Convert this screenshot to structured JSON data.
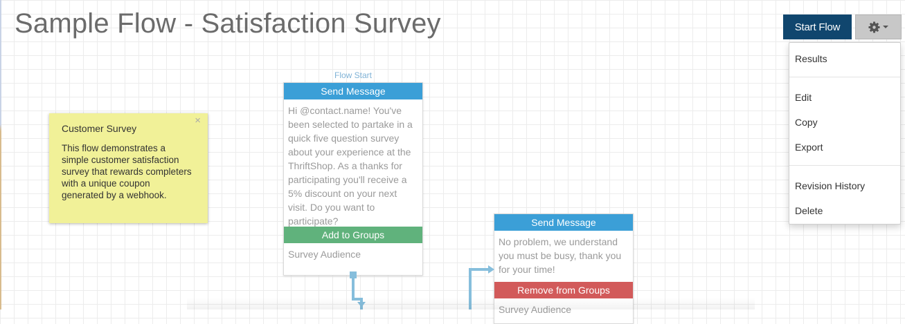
{
  "header": {
    "title": "Sample Flow - Satisfaction Survey",
    "start_flow_label": "Start Flow"
  },
  "settings_menu": {
    "items": [
      "Results",
      "Edit",
      "Copy",
      "Export",
      "Revision History",
      "Delete"
    ]
  },
  "note": {
    "title": "Customer Survey",
    "body": "This flow demonstrates a simple customer satisfaction survey that rewards completers with a unique coupon generated by a webhook.",
    "close_glyph": "×"
  },
  "flow_start_label": "Flow Start",
  "node1": {
    "message_header": "Send Message",
    "message_text": "Hi @contact.name! You've been selected to partake in a quick five question survey about your experience at the ThriftShop. As a thanks for participating you'll receive a 5% discount on your next visit. Do you want to participate?",
    "groups_header": "Add to Groups",
    "groups_text": "Survey Audience"
  },
  "node2": {
    "message_header": "Send Message",
    "message_text": "No problem, we understand you must be busy, thank you for your time!",
    "groups_header": "Remove from Groups",
    "groups_text": "Survey Audience"
  },
  "icons": {
    "settings": "gear-icon",
    "menu_caret": "caret-down-icon",
    "note_close": "close-icon"
  },
  "colors": {
    "primary_button": "#10466e",
    "send_message_header": "#3b9fd7",
    "add_groups_header": "#60b27c",
    "remove_groups_header": "#d25a5a",
    "note_background": "#f1f198",
    "connector": "#86bedc"
  }
}
